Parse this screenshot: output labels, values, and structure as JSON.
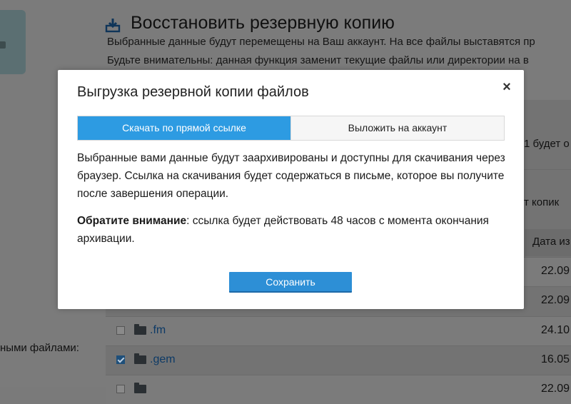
{
  "background": {
    "title": "Восстановить резервную копию",
    "line1": "Выбранные данные будут перемещены на Ваш аккаунт. На все файлы выставятся пр",
    "line2": "Будьте внимательны: данная функция заменит текущие файлы или директории на в",
    "fragment_upper": "1 будет о",
    "fragment_lower": "т копик",
    "date_header": "Дата из",
    "left_label": "ными файлами:",
    "rows": [
      {
        "name": "",
        "date": "22.09",
        "checked": false
      },
      {
        "name": "",
        "date": "22.09",
        "checked": false
      },
      {
        "name": ".fm",
        "date": "24.10",
        "checked": false
      },
      {
        "name": ".gem",
        "date": "16.05",
        "checked": true
      },
      {
        "name": "",
        "date": "22.09",
        "checked": false
      }
    ]
  },
  "modal": {
    "title": "Выгрузка резервной копии файлов",
    "close_symbol": "×",
    "tabs": [
      {
        "label": "Скачать по прямой ссылке",
        "active": true
      },
      {
        "label": "Выложить на аккаунт",
        "active": false
      }
    ],
    "description": "Выбранные вами данные будут заархивированы и доступны для скачивания через браузер. Ссылка на скачивания будет содержаться в письме, которое вы получите после завершения операции.",
    "note_label": "Обратите внимание",
    "note_text": ": ссылка будет действовать 48 часов с момента окончания архивации.",
    "save_label": "Сохранить"
  },
  "colors": {
    "accent": "#2d9be2",
    "button": "#2d8fd6",
    "overlay": "#7b7b7b"
  }
}
